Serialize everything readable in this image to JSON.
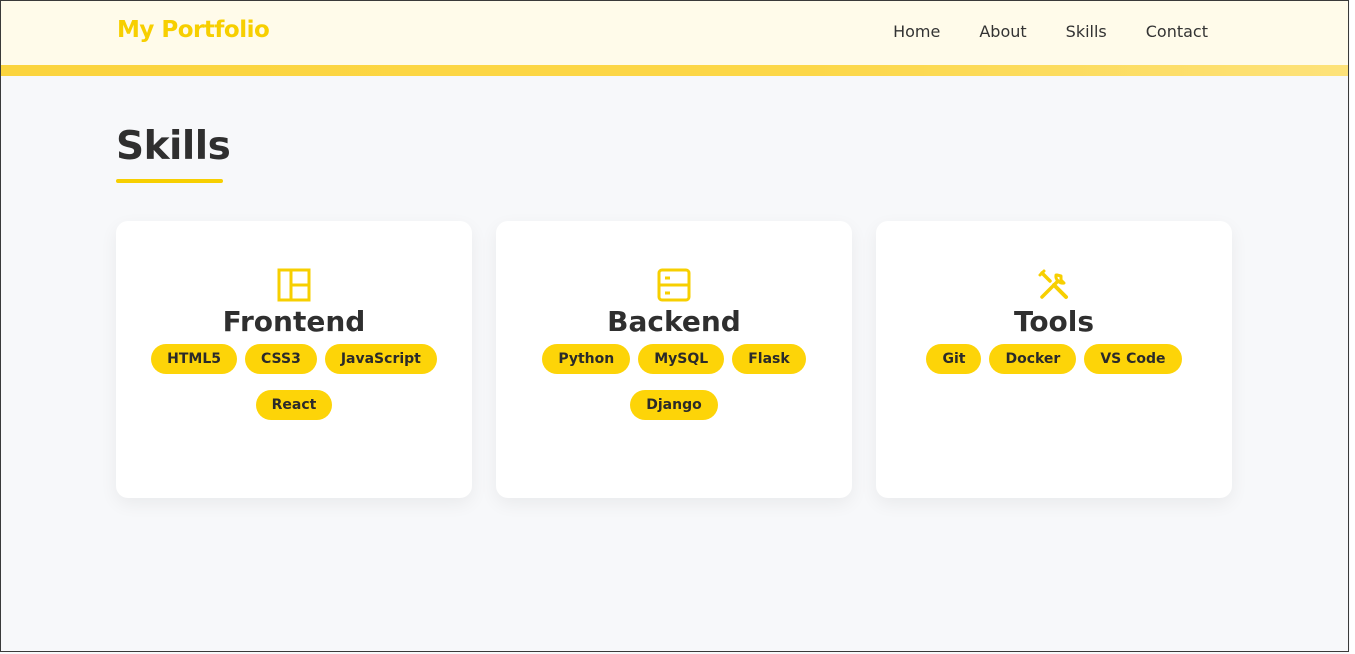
{
  "header": {
    "logo": "My Portfolio",
    "nav": [
      "Home",
      "About",
      "Skills",
      "Contact"
    ]
  },
  "section": {
    "title": "Skills"
  },
  "cards": [
    {
      "icon": "layout-icon",
      "title": "Frontend",
      "tags": [
        "HTML5",
        "CSS3",
        "JavaScript",
        "React"
      ]
    },
    {
      "icon": "server-icon",
      "title": "Backend",
      "tags": [
        "Python",
        "MySQL",
        "Flask",
        "Django"
      ]
    },
    {
      "icon": "tools-icon",
      "title": "Tools",
      "tags": [
        "Git",
        "Docker",
        "VS Code"
      ]
    }
  ],
  "colors": {
    "accent": "#f7cf00",
    "tag_bg": "#fdd408",
    "header_bg": "#fffbea",
    "page_bg": "#f7f8fa"
  }
}
